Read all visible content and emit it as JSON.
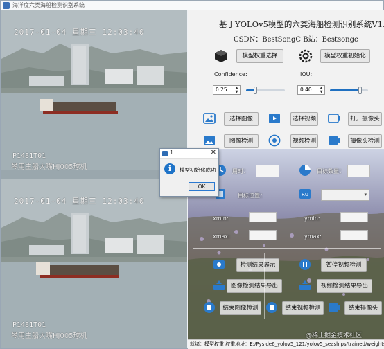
{
  "window": {
    "title": "海洋度六类海船检测识别系统"
  },
  "video": {
    "top": {
      "timestamp": "2017-01-04  星期三  12:03:40",
      "camera_id": "P1481T01",
      "camera_name": "琴用主船大嘴HJ005球机"
    },
    "bottom": {
      "timestamp": "2017-01-04  星期三  12:03:40",
      "camera_id": "P1481T01",
      "camera_name": "琴用主船大嘴HJ005球机"
    }
  },
  "header": {
    "title": "基于YOLOv5模型的六类海船检测识别系统V1.0",
    "credits": "CSDN：BestSongC   B站：Bestsongc"
  },
  "model": {
    "select_label": "模型权重选择",
    "init_label": "模型权重初始化"
  },
  "thresholds": {
    "confidence_label": "Confidence:",
    "confidence_value": "0.25",
    "confidence_fraction": 0.25,
    "iou_label": "IOU:",
    "iou_value": "0.40",
    "iou_fraction": 0.8
  },
  "actions": {
    "select_image": "选择图像",
    "select_video": "选择视频",
    "open_camera": "打开摄像头",
    "image_detect": "图像检测",
    "video_detect": "视频检测",
    "camera_detect": "摄像头检测"
  },
  "stats": {
    "time_label": "用时：",
    "count_label": "目标数量：",
    "position_label": "目标位置：",
    "xmin_label": "xmin:",
    "ymin_label": "ymin:",
    "xmax_label": "xmax:",
    "ymax_label": "ymax:"
  },
  "controls": {
    "show_results": "检测结果展示",
    "pause_video": "暂停视频检测",
    "export_image": "图像检测结果导出",
    "export_video": "视频检测结果导出",
    "end_image": "结束图像检测",
    "end_video": "结束视频检测",
    "end_camera": "结束摄像头"
  },
  "statusbar": {
    "text": "就绪：模型权重   权重地址：E:/Pyside6_yolov5_121/yolov5_seaships/trained/weights/best.pt"
  },
  "dialog": {
    "title": "1",
    "message": "模型初始化成功",
    "ok_label": "OK"
  },
  "watermark": "@稀土掘金技术社区",
  "colors": {
    "accent": "#1f70c1",
    "panel": "#f2f2f2"
  },
  "icons": [
    "cube-icon",
    "gear-icon",
    "image-icon",
    "video-icon",
    "camera-icon",
    "clock-icon",
    "pie-icon",
    "target-icon",
    "list-icon",
    "screen-icon",
    "eye-icon",
    "upload-icon",
    "stop-icon"
  ]
}
